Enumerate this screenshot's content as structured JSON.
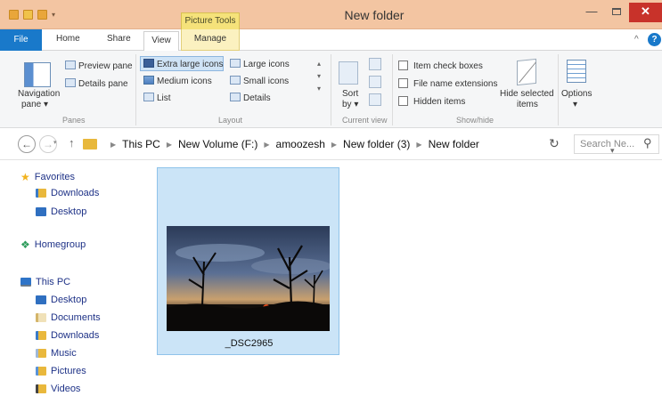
{
  "window": {
    "title": "New folder",
    "context_tab_group": "Picture Tools",
    "minimize_glyph": "—",
    "close_glyph": "✕"
  },
  "tabs": {
    "file": "File",
    "home": "Home",
    "share": "Share",
    "view": "View",
    "manage": "Manage",
    "collapse_glyph": "^",
    "help_glyph": "?"
  },
  "ribbon": {
    "panes": {
      "group_label": "Panes",
      "navigation_pane_line1": "Navigation",
      "navigation_pane_line2": "pane",
      "preview_pane": "Preview pane",
      "details_pane": "Details pane"
    },
    "layout": {
      "group_label": "Layout",
      "extra_large_icons": "Extra large icons",
      "large_icons": "Large icons",
      "medium_icons": "Medium icons",
      "small_icons": "Small icons",
      "list": "List",
      "details": "Details",
      "selected": "Extra large icons"
    },
    "current_view": {
      "group_label": "Current view",
      "sort_line1": "Sort",
      "sort_line2": "by"
    },
    "show_hide": {
      "group_label": "Show/hide",
      "item_check_boxes": "Item check boxes",
      "file_name_extensions": "File name extensions",
      "hidden_items": "Hidden items",
      "hide_selected_line1": "Hide selected",
      "hide_selected_line2": "items"
    },
    "options": "Options"
  },
  "address": {
    "crumbs": [
      "This PC",
      "New Volume (F:)",
      "amoozesh",
      "New folder (3)",
      "New folder"
    ],
    "search_placeholder": "Search Ne..."
  },
  "nav_pane": {
    "favorites": "Favorites",
    "favorites_items": [
      "Downloads",
      "Desktop"
    ],
    "homegroup": "Homegroup",
    "this_pc": "This PC",
    "this_pc_items": [
      "Desktop",
      "Documents",
      "Downloads",
      "Music",
      "Pictures",
      "Videos"
    ]
  },
  "content": {
    "files": [
      {
        "name": "_DSC2965",
        "selected": true
      }
    ]
  },
  "colors": {
    "title_bar": "#f3c5a2",
    "file_tab": "#1979ca",
    "close_button": "#c8322a",
    "selection_fill": "#cbe4f7"
  }
}
